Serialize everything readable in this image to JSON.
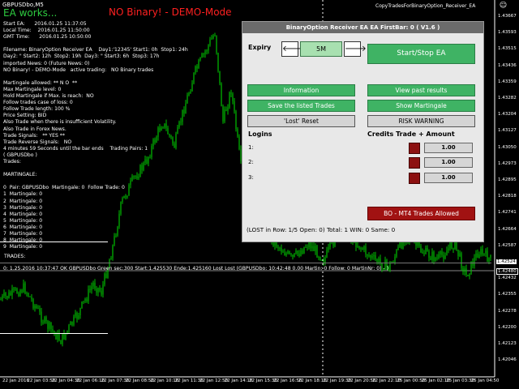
{
  "chart": {
    "symbol_title": "GBPUSDbo,M5",
    "ea_status": "EA works...",
    "demo_banner": "NO Binary! - DEMO-Mode",
    "window_title": "CopyTradesForBinaryOption_Receiver_EA",
    "smile": "☺",
    "current_price": "1.42524",
    "secondary_price": "1.42480",
    "price_labels": [
      "1.43667",
      "1.43593",
      "1.43515",
      "1.43436",
      "1.43359",
      "1.43282",
      "1.43204",
      "1.43127",
      "1.43050",
      "1.42973",
      "1.42895",
      "1.42818",
      "1.42741",
      "1.42664",
      "1.42587",
      "1.42509",
      "1.42432",
      "1.42355",
      "1.42278",
      "1.42200",
      "1.42123",
      "1.42046"
    ],
    "time_labels": [
      "22 Jan 2016",
      "22 Jan 03:50",
      "22 Jan 04:30",
      "22 Jan 06:10",
      "22 Jan 07:30",
      "22 Jan 08:50",
      "22 Jan 10:10",
      "22 Jan 11:30",
      "22 Jan 12:50",
      "22 Jan 14:10",
      "22 Jan 15:30",
      "22 Jan 16:50",
      "22 Jan 18:10",
      "22 Jan 19:30",
      "22 Jan 20:50",
      "22 Jan 22:10",
      "25 Jan 00:50",
      "25 Jan 02:10",
      "25 Jan 03:30",
      "25 Jan 04:50"
    ],
    "time_marker": "22 Jan 22:10"
  },
  "info_lines": [
    "Start EA:      2016.01.25 11:37:05",
    "Local Time:    2016.01.25 11:50:00",
    "GMT Time:      2016.01.25 10:50:00",
    "",
    "Filename: BinaryOption Receiver EA    Day1:'12345' Start1: 0h  Stop1: 24h",
    "Day2: \" Start2: 12h  Stop2: 19h  Day3: \" Start3: 6h  Stop3: 17h",
    "imported News: 0 (Future News: 0)",
    "NO Binary! - DEMO-Mode   active trading:   NO Binary trades",
    "",
    "Martingale allowed: ** N O  **",
    "Max Martingale level: 0",
    "Hold Martingale if Max. is reach:  NO",
    "Follow trades case of loss: 0",
    "Follow Trade length: 100 %",
    "Price Setting: BID",
    "Also Trade when there is insufficient Volatility.",
    "Also Trade in Forex News.",
    "Trade Signals:   ** YES **",
    "Trade Reverse Signals:   NO",
    "4 minutes 59 Seconds until the bar ends    Trading Pairs: 1",
    "( GBPUSDbo )",
    "Trades:",
    "",
    "MARTINGALE:",
    "",
    "0  Pair: GBPUSDbo  Martingale: 0  Follow Trade: 0",
    "1  Martingale: 0",
    "2  Martingale: 0",
    "3  Martingale: 0",
    "4  Martingale: 0",
    "5  Martingale: 0",
    "6  Martingale: 0",
    "7  Martingale: 0",
    "8  Martingale: 0",
    "9  Martingale: 0"
  ],
  "trades_label": "TRADES:",
  "trade_line": "0: 1.25.2016 10:37:47 OK GBPUSDbo   Green  sec:300 Start:1.425530 Ende:1.425160 Lost Lost (GBPUSDbo: 10:42:48 0.00   Martin: 0   Follow: 0   MartinNr: 0) - )",
  "panel": {
    "title": "BinaryOption Receiver EA EA   FirstBar: 0   ( V1.6 )",
    "expiry_label": "Expiry",
    "prev_arrow": "🡐",
    "next_arrow": "🡒",
    "timeframe": "5M",
    "start_stop": "Start/Stop EA",
    "information": "Information",
    "view_past": "View past results",
    "save_trades": "Save the listed Trades",
    "show_martingale": "Show Martingale",
    "lost_reset": "'Lost' Reset",
    "risk_warning": "RISK WARNING",
    "logins_header": "Logins",
    "credits_header": "Credits   Trade + Amount",
    "logins": [
      {
        "label": "1:",
        "amount": "1.00"
      },
      {
        "label": "2:",
        "amount": "1.00"
      },
      {
        "label": "3:",
        "amount": "1.00"
      }
    ],
    "mt4_button": "BO - MT4 Trades Allowed",
    "status": "(LOST in Row: 1/5   Open: 0) Total: 1 WIN: 0 Same: 0"
  },
  "colors": {
    "candle": "#00c000",
    "panel_bg": "#e8e8e8",
    "button_green": "#3fb364",
    "button_red": "#a11212"
  }
}
